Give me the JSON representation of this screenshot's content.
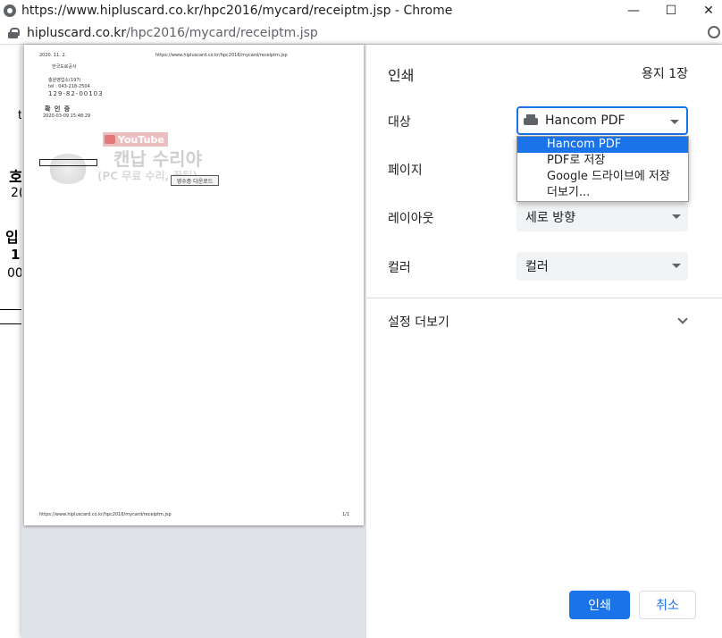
{
  "window": {
    "title": "https://www.hipluscard.co.kr/hpc2016/mycard/receiptm.jsp - Chrome",
    "minimize": "—",
    "maximize": "☐",
    "close": "✕"
  },
  "address": {
    "domain": "hipluscard.co.kr",
    "path": "/hpc2016/mycard/receiptm.jsp"
  },
  "background_page": {
    "fragments": [
      "t",
      "호",
      "2(",
      "입",
      "1.",
      "00"
    ]
  },
  "preview": {
    "date": "2020. 11. 2.",
    "url_top": "https://www.hipluscard.co.kr/hpc2016/mycard/receiptm.jsp",
    "company": "한국도로공사",
    "office": "충원영업소(197)",
    "tel": "tel : 043-218-2504",
    "bizno": "129-82-00103",
    "confirm": "확 인 증",
    "datetime": "2020-03-09 15:48:29",
    "download_button": "영수증 다운로드",
    "url_bottom": "https://www.hipluscard.co.kr/hpc2016/mycard/receiptm.jsp",
    "page_num": "1/1",
    "watermark_youtube": "YouTube",
    "watermark_title": "캔납 수리야",
    "watermark_sub": "(PC 무료 수리, 꿀팁)"
  },
  "print": {
    "title": "인쇄",
    "pages_count": "용지 1장",
    "destination_label": "대상",
    "destination_value": "Hancom PDF",
    "destination_options": [
      "Hancom PDF",
      "PDF로 저장",
      "Google 드라이브에 저장",
      "더보기..."
    ],
    "pages_label": "페이지",
    "layout_label": "레이아웃",
    "layout_value": "세로 방향",
    "color_label": "컬러",
    "color_value": "컬러",
    "more_settings": "설정 더보기",
    "print_button": "인쇄",
    "cancel_button": "취소"
  }
}
